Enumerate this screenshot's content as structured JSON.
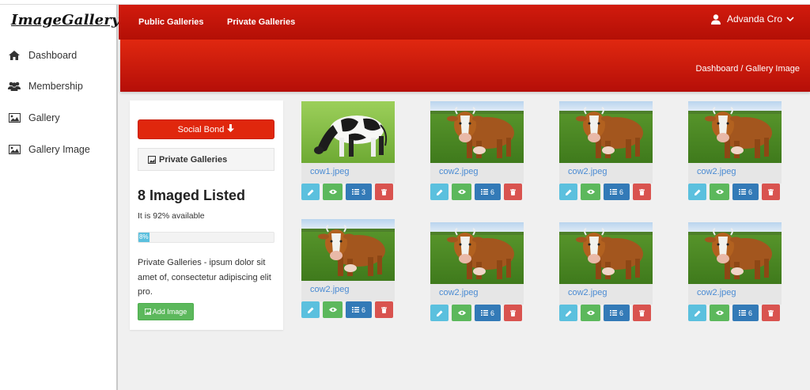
{
  "app": {
    "logo": "ImageGallery"
  },
  "sidebar": {
    "items": [
      {
        "label": "Dashboard",
        "icon": "home-icon"
      },
      {
        "label": "Membership",
        "icon": "users-icon"
      },
      {
        "label": "Gallery",
        "icon": "picture-icon"
      },
      {
        "label": "Gallery Image",
        "icon": "picture-icon"
      }
    ]
  },
  "header": {
    "links": [
      "Public Galleries",
      "Private Galleries"
    ],
    "user": "Advanda Cro"
  },
  "breadcrumb": "Dashboard / Gallery Image",
  "panel": {
    "social_button": "Social Bond",
    "private_title": "Private Galleries",
    "count_title": "8 Imaged Listed",
    "availability": "It is 92% available",
    "progress_percent": 8,
    "progress_label": "8%",
    "description": "Private Galleries - ipsum dolor sit amet of, consectetur adipiscing elit pro.",
    "add_button": "Add Image"
  },
  "colors": {
    "brand_red": "#d21b0d",
    "info": "#5bc0de",
    "success": "#5cb85c",
    "primary": "#337ab7",
    "danger": "#d9534f",
    "link": "#4a8bd3"
  },
  "gallery": [
    {
      "file": "cow1.jpeg",
      "count": "3",
      "image": "holstein-cow-grazing"
    },
    {
      "file": "cow2.jpeg",
      "count": "6",
      "image": "brown-cow-field"
    },
    {
      "file": "cow2.jpeg",
      "count": "6",
      "image": "brown-cow-field"
    },
    {
      "file": "cow2.jpeg",
      "count": "6",
      "image": "brown-cow-field"
    },
    {
      "file": "cow2.jpeg",
      "count": "6",
      "image": "brown-cow-field"
    },
    {
      "file": "cow2.jpeg",
      "count": "6",
      "image": "brown-cow-field"
    },
    {
      "file": "cow2.jpeg",
      "count": "6",
      "image": "brown-cow-field"
    },
    {
      "file": "cow2.jpeg",
      "count": "6",
      "image": "brown-cow-field"
    }
  ]
}
